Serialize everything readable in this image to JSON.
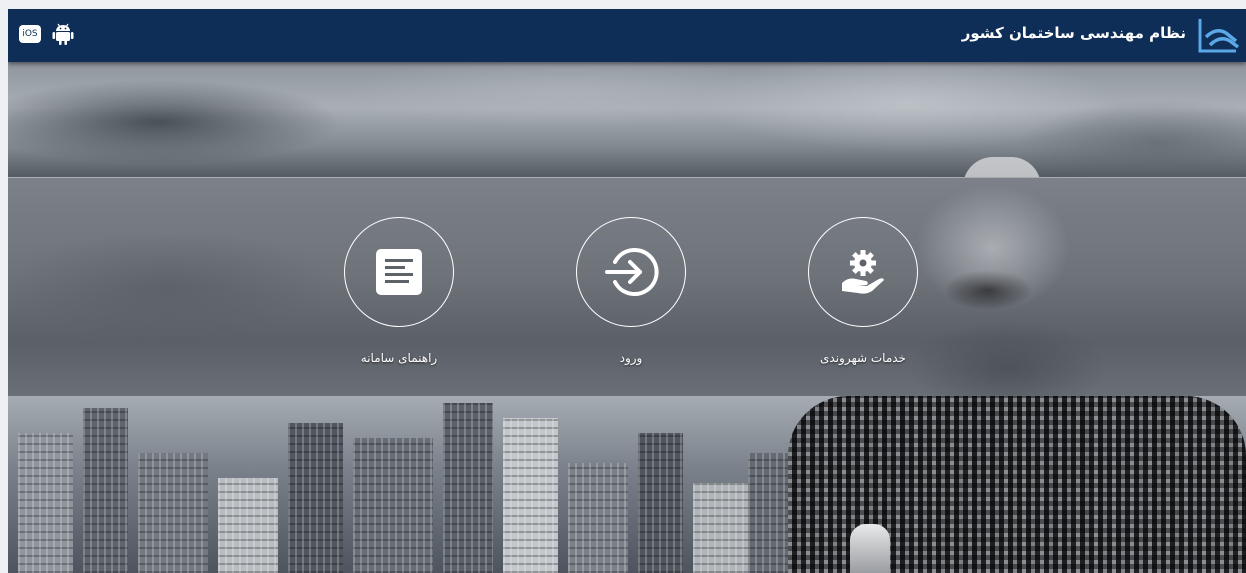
{
  "header": {
    "title": "نظام مهندسی ساختمان کشور",
    "logo_icon": "brand-logo-icon",
    "ios_badge": "iOS",
    "android_icon": "android-icon"
  },
  "actions": [
    {
      "label": "خدمات شهروندی",
      "icon": "hand-gear-icon"
    },
    {
      "label": "ورود",
      "icon": "login-arrow-icon"
    },
    {
      "label": "راهنمای سامانه",
      "icon": "document-icon"
    }
  ],
  "colors": {
    "header_bg": "#0e2d57",
    "tile_border": "#ffffff"
  }
}
